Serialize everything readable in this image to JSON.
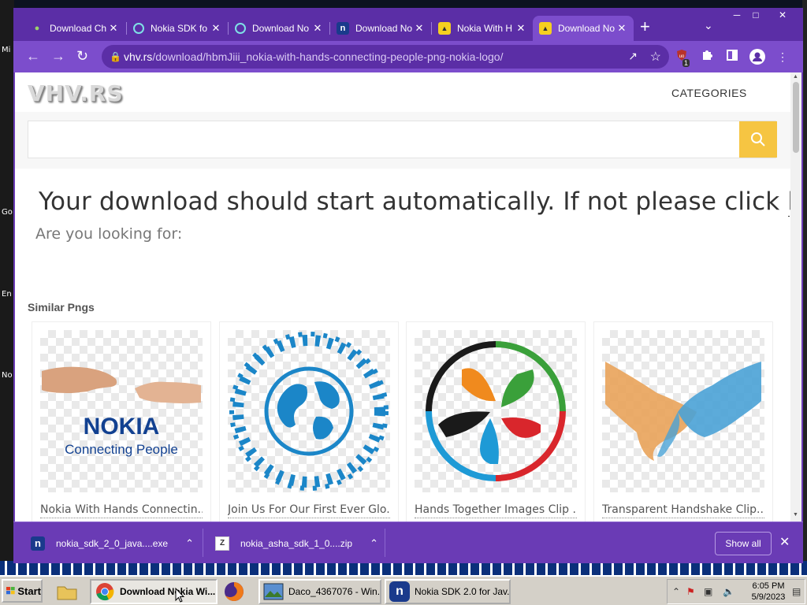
{
  "desktop": {
    "side_labels": [
      "Mi",
      "Go",
      "En",
      "No"
    ]
  },
  "window_controls": [
    "─",
    "□",
    "✕"
  ],
  "tabs": [
    {
      "title": "Download Ch",
      "favicon": "puzzle-favicon",
      "active": false
    },
    {
      "title": "Nokia SDK fo",
      "favicon": "q-favicon",
      "active": false
    },
    {
      "title": "Download No",
      "favicon": "q-favicon",
      "active": false
    },
    {
      "title": "Download No",
      "favicon": "n-favicon",
      "active": false
    },
    {
      "title": "Nokia With H",
      "favicon": "image-favicon",
      "active": false
    },
    {
      "title": "Download No",
      "favicon": "image-favicon",
      "active": true
    }
  ],
  "new_tab_label": "+",
  "address_bar": {
    "host": "vhv.rs",
    "path": "/download/hbmJiii_nokia-with-hands-connecting-people-png-nokia-logo/"
  },
  "toolbar": {
    "ext_badge": "1"
  },
  "page": {
    "logo_text": "VHV.RS",
    "nav_categories": "CATEGORIES",
    "search_placeholder": "",
    "headline_prefix": "Your download should start automatically. If not please click ",
    "headline_link": "here",
    "headline_suffix": ".",
    "looking_for": "Are you looking for:",
    "similar_heading": "Similar Pngs",
    "cards": [
      {
        "caption": "Nokia With Hands Connectin...",
        "art": "nokia-logo-hands"
      },
      {
        "caption": "Join Us For Our First Ever Glo...",
        "art": "globe-people-ring"
      },
      {
        "caption": "Hands Together Images Clip ...",
        "art": "colorful-hands-circle"
      },
      {
        "caption": "Transparent Handshake Clip...",
        "art": "handshake-mosaic"
      }
    ],
    "nokia_wordmark": "NOKIA",
    "nokia_tagline": "Connecting People"
  },
  "downloads": [
    {
      "filename": "nokia_sdk_2_0_java....exe",
      "icon": "n-icon"
    },
    {
      "filename": "nokia_asha_sdk_1_0....zip",
      "icon": "zip-icon"
    }
  ],
  "show_all_label": "Show all",
  "taskbar": {
    "start_label": "Start",
    "buttons": [
      {
        "label": "Download Nokia Wi...",
        "icon": "chrome-icon",
        "pressed": true
      },
      {
        "label": "Daco_4367076 - Win...",
        "icon": "image-viewer-icon",
        "pressed": false
      },
      {
        "label": "Nokia SDK 2.0 for Jav...",
        "icon": "n-app-icon",
        "pressed": false
      }
    ],
    "clock_time": "6:05 PM",
    "clock_date": "5/9/2023"
  },
  "colors": {
    "browser_frame": "#6a3bb5",
    "toolbar": "#7c4dcc",
    "search_button": "#f6c542",
    "nokia_blue": "#124191"
  }
}
